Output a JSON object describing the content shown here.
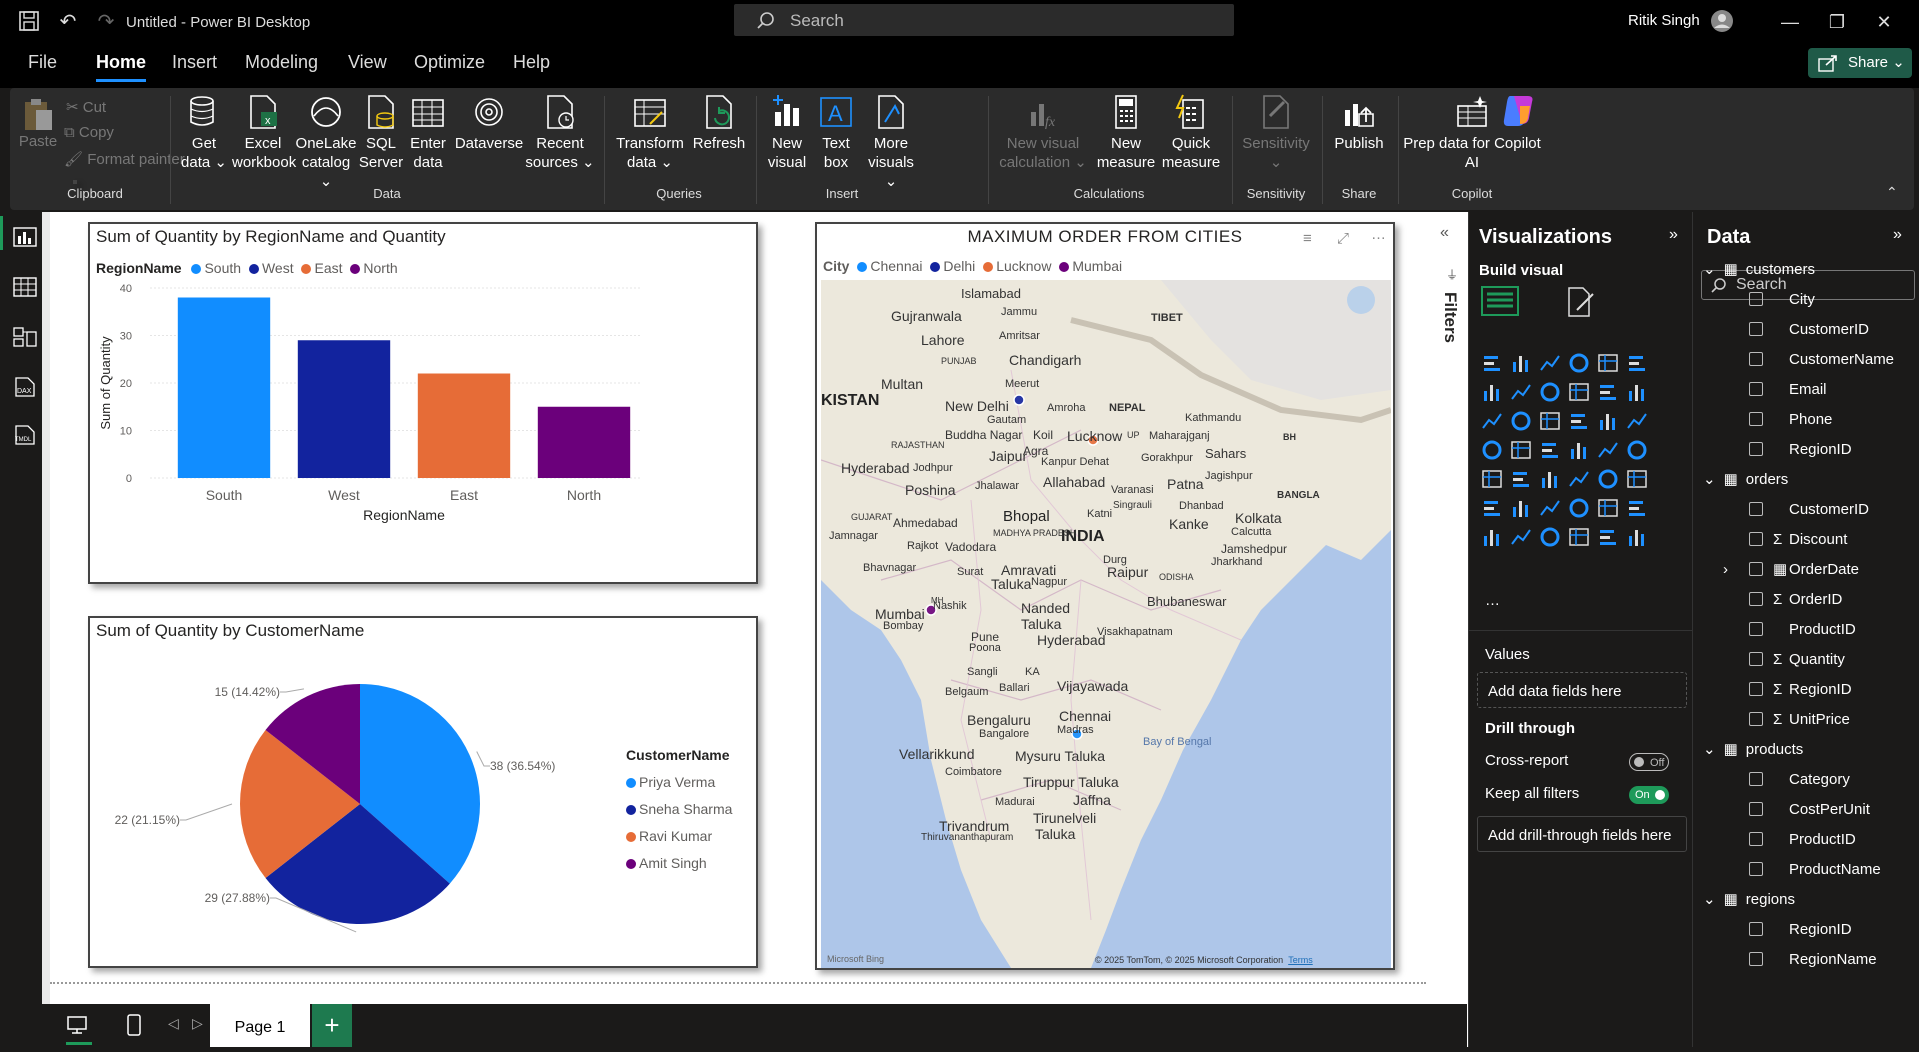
{
  "window": {
    "title": "Untitled - Power BI Desktop",
    "search_placeholder": "Search",
    "user": "Ritik Singh"
  },
  "menu": [
    "File",
    "Home",
    "Insert",
    "Modeling",
    "View",
    "Optimize",
    "Help"
  ],
  "share_label": "Share",
  "ribbon": {
    "clipboard": {
      "paste": "Paste",
      "cut": "Cut",
      "copy": "Copy",
      "format_painter": "Format painter",
      "group": "Clipboard"
    },
    "data": {
      "get_data": [
        "Get",
        "data ⌄"
      ],
      "excel": [
        "Excel",
        "workbook"
      ],
      "onelake": [
        "OneLake",
        "catalog ⌄"
      ],
      "sql": [
        "SQL",
        "Server"
      ],
      "enter": [
        "Enter",
        "data"
      ],
      "dataverse": [
        "Dataverse",
        ""
      ],
      "recent": [
        "Recent",
        "sources ⌄"
      ],
      "group": "Data"
    },
    "queries": {
      "transform": [
        "Transform",
        "data ⌄"
      ],
      "refresh": [
        "Refresh",
        ""
      ],
      "group": "Queries"
    },
    "insert": {
      "new_visual": [
        "New",
        "visual"
      ],
      "text_box": [
        "Text",
        "box"
      ],
      "more_visuals": [
        "More",
        "visuals ⌄"
      ],
      "group": "Insert"
    },
    "calculations": {
      "new_visual_calc": [
        "New visual",
        "calculation ⌄"
      ],
      "new_measure": [
        "New",
        "measure"
      ],
      "quick_measure": [
        "Quick",
        "measure"
      ],
      "group": "Calculations"
    },
    "sensitivity": {
      "label": [
        "Sensitivity",
        "⌄"
      ],
      "group": "Sensitivity"
    },
    "share": {
      "publish": "Publish",
      "group": "Share"
    },
    "copilot": {
      "prep": [
        "Prep data for Copilot",
        "AI"
      ],
      "group": "Copilot"
    }
  },
  "visual_bar": {
    "title": "Sum of Quantity by RegionName and Quantity",
    "legend_title": "RegionName",
    "legend": [
      "South",
      "West",
      "East",
      "North"
    ]
  },
  "visual_pie": {
    "title": "Sum of Quantity by CustomerName",
    "legend_title": "CustomerName",
    "legend": [
      "Priya Verma",
      "Sneha Sharma",
      "Ravi Kumar",
      "Amit Singh"
    ]
  },
  "visual_map": {
    "title": "MAXIMUM ORDER FROM CITIES",
    "legend_title": "City",
    "legend": [
      "Chennai",
      "Delhi",
      "Lucknow",
      "Mumbai"
    ],
    "labels": [
      "Islamabad",
      "Jammu",
      "Gujranwala",
      "Amritsar",
      "Lahore",
      "TIBET",
      "PUNJAB",
      "Chandigarh",
      "Multan",
      "Meerut",
      "KISTAN",
      "New Delhi",
      "Amroha",
      "NEPAL",
      "Kathmandu",
      "Gautam",
      "Buddha Nagar",
      "Koil",
      "Lucknow",
      "UP",
      "Maharajganj",
      "RAJASTHAN",
      "Agra",
      "Gorakhpur",
      "Jaipur",
      "Kanpur Dehat",
      "Sahars",
      "Hyderabad",
      "Jodhpur",
      "Allahabad",
      "BH",
      "Poshina",
      "Jhalawar",
      "Varanasi",
      "Patna",
      "Jagishpur",
      "Singrauli",
      "Dhanbad",
      "BANGLA",
      "GUJARAT",
      "Bhopal",
      "Katni",
      "Kanke",
      "Kolkata",
      "Ahmedabad",
      "INDIA",
      "Jamnagar",
      "Calcutta",
      "Rajkot",
      "Vadodara",
      "MADHYA PRADESH",
      "Jamshedpur",
      "Bhavnagar",
      "Surat",
      "Amravati",
      "Durg",
      "Jharkhand",
      "Taluka",
      "Raipur",
      "ODISHA",
      "Nagpur",
      "Mumbai",
      "Bombay",
      "Nashik",
      "MH",
      "Nanded",
      "Taluka",
      "Bhubaneswar",
      "Pune",
      "Hyderabad",
      "Visakhapatnam",
      "Poona",
      "Sangli",
      "KA",
      "Vijayawada",
      "Belgaum",
      "Ballari",
      "Bengaluru",
      "Bangalore",
      "Chennai",
      "Madras",
      "Bay of Bengal",
      "Vellarikkund",
      "Mysuru Taluka",
      "Coimbatore",
      "Tiruppur Taluka",
      "Jaffna",
      "Madurai",
      "Trivandrum",
      "Tirunelveli",
      "Thiruvananthapuram",
      "Taluka"
    ],
    "attribution": "© 2025 TomTom, © 2025 Microsoft Corporation",
    "terms": "Terms",
    "brand": "Microsoft Bing"
  },
  "chart_data": [
    {
      "type": "bar",
      "title": "Sum of Quantity by RegionName and Quantity",
      "categories": [
        "South",
        "West",
        "East",
        "North"
      ],
      "values": [
        38,
        29,
        22,
        15
      ],
      "colors": [
        "#118dff",
        "#12239e",
        "#e66c37",
        "#6b007b"
      ],
      "xlabel": "RegionName",
      "ylabel": "Sum of Quantity",
      "ylim": [
        0,
        40
      ],
      "yticks": [
        0,
        10,
        20,
        30,
        40
      ],
      "legend_position": "top-left"
    },
    {
      "type": "pie",
      "title": "Sum of Quantity by CustomerName",
      "categories": [
        "Priya Verma",
        "Sneha Sharma",
        "Ravi Kumar",
        "Amit Singh"
      ],
      "values": [
        38,
        29,
        22,
        15
      ],
      "labels": [
        "38 (36.54%)",
        "29 (27.88%)",
        "22 (21.15%)",
        "15 (14.42%)"
      ],
      "colors": [
        "#118dff",
        "#12239e",
        "#e66c37",
        "#6b007b"
      ],
      "legend_position": "right"
    }
  ],
  "filters_label": "Filters",
  "page_tab": "Page 1",
  "viz_pane": {
    "title": "Visualizations",
    "build": "Build visual",
    "values": "Values",
    "add_fields": "Add data fields here",
    "drill": "Drill through",
    "cross_report": "Cross-report",
    "cross_state": "Off",
    "keep_filters": "Keep all filters",
    "keep_state": "On",
    "add_drill": "Add drill-through fields here"
  },
  "data_pane": {
    "title": "Data",
    "search_placeholder": "Search",
    "tables": [
      {
        "name": "customers",
        "fields": [
          {
            "n": "City",
            "s": ""
          },
          {
            "n": "CustomerID",
            "s": ""
          },
          {
            "n": "CustomerName",
            "s": ""
          },
          {
            "n": "Email",
            "s": ""
          },
          {
            "n": "Phone",
            "s": ""
          },
          {
            "n": "RegionID",
            "s": ""
          }
        ]
      },
      {
        "name": "orders",
        "fields": [
          {
            "n": "CustomerID",
            "s": ""
          },
          {
            "n": "Discount",
            "s": "Σ"
          },
          {
            "n": "OrderDate",
            "s": "▦"
          },
          {
            "n": "OrderID",
            "s": "Σ"
          },
          {
            "n": "ProductID",
            "s": ""
          },
          {
            "n": "Quantity",
            "s": "Σ"
          },
          {
            "n": "RegionID",
            "s": "Σ"
          },
          {
            "n": "UnitPrice",
            "s": "Σ"
          }
        ]
      },
      {
        "name": "products",
        "fields": [
          {
            "n": "Category",
            "s": ""
          },
          {
            "n": "CostPerUnit",
            "s": ""
          },
          {
            "n": "ProductID",
            "s": ""
          },
          {
            "n": "ProductName",
            "s": ""
          }
        ]
      },
      {
        "name": "regions",
        "fields": [
          {
            "n": "RegionID",
            "s": ""
          },
          {
            "n": "RegionName",
            "s": ""
          }
        ]
      }
    ]
  }
}
